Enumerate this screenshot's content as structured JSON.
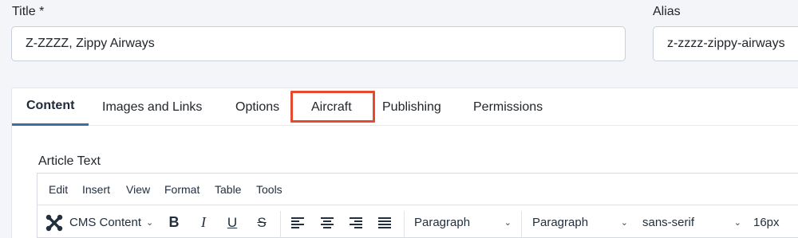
{
  "fields": {
    "title_label": "Title *",
    "title_value": "Z-ZZZZ, Zippy Airways",
    "alias_label": "Alias",
    "alias_value": "z-zzzz-zippy-airways"
  },
  "tabs": [
    {
      "label": "Content",
      "active": true
    },
    {
      "label": "Images and Links"
    },
    {
      "label": "Options"
    },
    {
      "label": "Aircraft",
      "highlighted": true
    },
    {
      "label": "Publishing"
    },
    {
      "label": "Permissions"
    }
  ],
  "editor": {
    "label": "Article Text",
    "menu": [
      "Edit",
      "Insert",
      "View",
      "Format",
      "Table",
      "Tools"
    ],
    "toolbar": {
      "cms_content": "CMS Content",
      "block_format": "Paragraph",
      "style_format": "Paragraph",
      "font_family": "sans-serif",
      "font_size": "16px"
    }
  },
  "colors": {
    "highlight_border": "#e64a2e",
    "active_tab_underline": "#3b6ea5"
  }
}
